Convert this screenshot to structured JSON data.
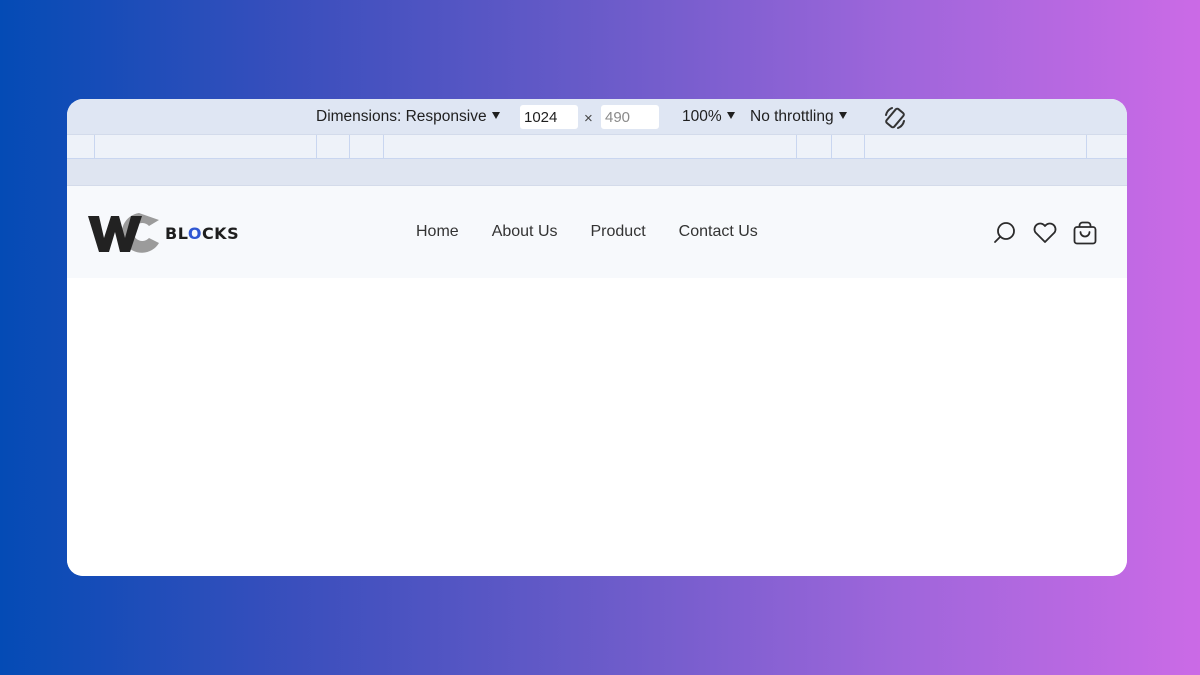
{
  "device_toolbar": {
    "dimensions_label": "Dimensions: Responsive",
    "width_value": "1024",
    "height_placeholder": "490",
    "times_symbol": "×",
    "zoom_label": "100%",
    "throttle_label": "No throttling",
    "rotate_icon": "rotate-icon"
  },
  "site": {
    "logo_mark": "WC",
    "logo_text_before": "BL",
    "logo_text_accent": "O",
    "logo_text_after": "CKS",
    "nav": [
      {
        "label": "Home"
      },
      {
        "label": "About Us"
      },
      {
        "label": "Product"
      },
      {
        "label": "Contact Us"
      }
    ],
    "icons": [
      "search-icon",
      "heart-icon",
      "shopping-bag-icon"
    ]
  },
  "colors": {
    "background_gradient_start": "#044bb5",
    "background_gradient_end": "#cb6ae6",
    "toolbar_bg": "#dfe6f3",
    "logo_accent": "#2f57d3"
  }
}
